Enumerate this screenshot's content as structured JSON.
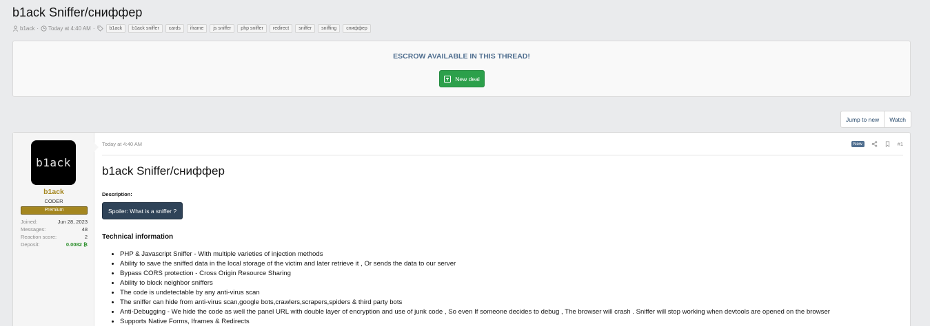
{
  "thread": {
    "title": "b1ack Sniffer/сниффер",
    "author": "b1ack",
    "date": "Today at 4:40 AM",
    "tags": [
      "b1ack",
      "b1ack sniffer",
      "cards",
      "iframe",
      "js sniffer",
      "php sniffer",
      "redirect",
      "sniffer",
      "sniffing",
      "сниффер"
    ]
  },
  "escrow": {
    "title": "ESCROW AVAILABLE IN THIS THREAD!",
    "button": "New deal"
  },
  "actions": {
    "jump": "Jump to new",
    "watch": "Watch"
  },
  "user": {
    "avatar_text": "b1ack",
    "name": "b1ack",
    "title": "CODER",
    "banner": "Premium",
    "stats": {
      "joined_label": "Joined:",
      "joined": "Jun 28, 2023",
      "messages_label": "Messages:",
      "messages": "48",
      "reaction_label": "Reaction score:",
      "reaction": "2",
      "deposit_label": "Deposit:",
      "deposit": "0.0082 ₿"
    }
  },
  "post": {
    "date": "Today at 4:40 AM",
    "new_badge": "New",
    "number": "#1",
    "title": "b1ack Sniffer/сниффер",
    "description_label": "Description:",
    "spoiler": "Spoiler: What is a sniffer ?",
    "tech_title": "Technical information",
    "features": [
      "PHP & Javascript Sniffer - With multiple varieties of injection methods",
      "Ability to save the sniffed data in the local storage of the victim and later retrieve it , Or sends the data to our server",
      "Bypass CORS protection - Cross Origin Resource Sharing",
      "Ability to block neighbor sniffers",
      "The code is undetectable by any anti-virus scan",
      "The sniffer can hide from anti-virus scan,google bots,crawlers,scrapers,spiders & third party bots",
      "Anti-Debugging - We hide the code as well the panel URL with double layer of encryption and use of junk code , So even If someone decides to debug , The browser will crash . Sniffer will stop working when devtools are opened on the browser",
      "Supports Native Forms, Iframes & Redirects"
    ]
  },
  "colors": {
    "accent": "#4f6e8f",
    "premium": "#a4861f",
    "deal_green": "#2ca04b",
    "spoiler_bg": "#2f4358"
  }
}
